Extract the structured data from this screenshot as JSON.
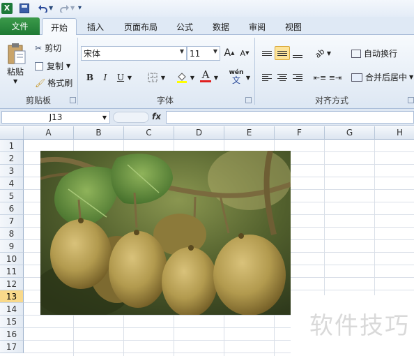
{
  "qat": {
    "app_icon": "X",
    "undo_icon": "undo-icon",
    "redo_icon": "redo-icon"
  },
  "tabs": [
    {
      "label": "文件"
    },
    {
      "label": "开始"
    },
    {
      "label": "插入"
    },
    {
      "label": "页面布局"
    },
    {
      "label": "公式"
    },
    {
      "label": "数据"
    },
    {
      "label": "审阅"
    },
    {
      "label": "视图"
    }
  ],
  "ribbon": {
    "paste": "粘贴",
    "cut": "剪切",
    "copy": "复制",
    "format_painter": "格式刷",
    "clipboard_group": "剪贴板",
    "font_name": "宋体",
    "font_size": "11",
    "grow_font": "A",
    "shrink_font": "A",
    "bold": "B",
    "italic": "I",
    "underline": "U",
    "font_color_glyph": "A",
    "phonetic_top": "wén",
    "phonetic_bottom": "文",
    "font_group": "字体",
    "wrap_text": "自动换行",
    "merge_center": "合并后居中",
    "alignment_group": "对齐方式"
  },
  "formula_bar": {
    "name_box": "J13",
    "fx": "fx",
    "formula": ""
  },
  "columns": [
    "A",
    "B",
    "C",
    "D",
    "E",
    "F",
    "G",
    "H"
  ],
  "rows": [
    "1",
    "2",
    "3",
    "4",
    "5",
    "6",
    "7",
    "8",
    "9",
    "10",
    "11",
    "12",
    "13",
    "14",
    "15",
    "16",
    "17"
  ],
  "active_row": "13",
  "watermark": "软件技巧",
  "colors": {
    "file_tab": "#1f7a34",
    "active_row_header": "#f9d98a",
    "accent": "#3b9a4a"
  }
}
